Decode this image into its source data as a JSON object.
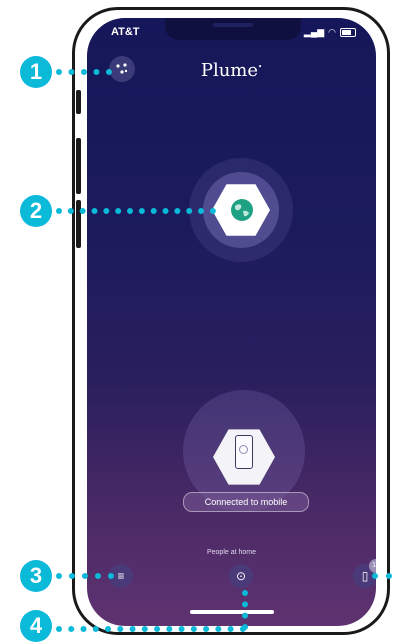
{
  "status_bar": {
    "carrier": "AT&T"
  },
  "header": {
    "logo": "Plume",
    "logo_mark": "•",
    "mesh_icon": "mesh-nodes-icon"
  },
  "network": {
    "hub_icon": "globe-icon"
  },
  "device": {
    "icon": "smartphone-icon",
    "status": "Connected to mobile"
  },
  "bottom_nav": {
    "people_label": "People at home",
    "left_icon": "menu-icon",
    "center_icon": "person-icon",
    "right_icon": "devices-icon",
    "devices_count": "10"
  },
  "callouts": [
    "1",
    "2",
    "3",
    "4"
  ],
  "colors": {
    "callout": "#0bb9d9",
    "background_top": "#15175a",
    "background_bottom": "#5e3370",
    "globe": "#1fa183"
  }
}
